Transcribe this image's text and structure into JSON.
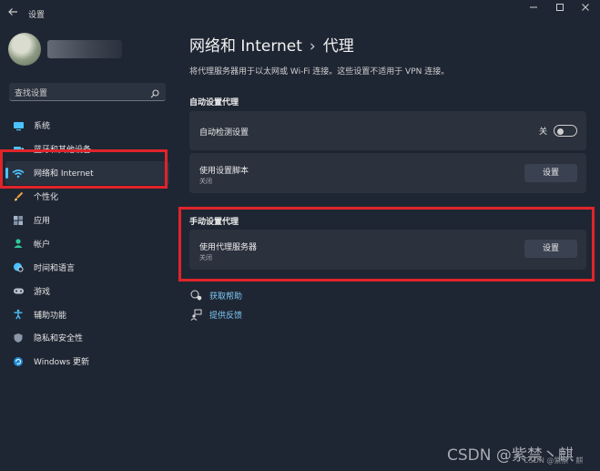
{
  "window": {
    "title": "设置"
  },
  "search": {
    "placeholder": "查找设置"
  },
  "sidebar": {
    "items": [
      {
        "label": "系统",
        "icon": "monitor-icon"
      },
      {
        "label": "蓝牙和其他设备",
        "icon": "bluetooth-icon"
      },
      {
        "label": "网络和 Internet",
        "icon": "wifi-icon",
        "active": true
      },
      {
        "label": "个性化",
        "icon": "brush-icon"
      },
      {
        "label": "应用",
        "icon": "apps-icon"
      },
      {
        "label": "帐户",
        "icon": "person-icon"
      },
      {
        "label": "时间和语言",
        "icon": "globe-clock-icon"
      },
      {
        "label": "游戏",
        "icon": "gamepad-icon"
      },
      {
        "label": "辅助功能",
        "icon": "accessibility-icon"
      },
      {
        "label": "隐私和安全性",
        "icon": "shield-icon"
      },
      {
        "label": "Windows 更新",
        "icon": "update-icon"
      }
    ]
  },
  "header": {
    "breadcrumb_parent": "网络和 Internet",
    "breadcrumb_sep": "›",
    "breadcrumb_current": "代理",
    "description": "将代理服务器用于以太网或 Wi-Fi 连接。这些设置不适用于 VPN 连接。"
  },
  "auto_proxy": {
    "section_title": "自动设置代理",
    "detect": {
      "label": "自动检测设置",
      "toggle_text": "关",
      "on": false
    },
    "script": {
      "label": "使用设置脚本",
      "sub": "关闭",
      "button": "设置"
    }
  },
  "manual_proxy": {
    "section_title": "手动设置代理",
    "server": {
      "label": "使用代理服务器",
      "sub": "关闭",
      "button": "设置"
    }
  },
  "links": {
    "help": "获取帮助",
    "feedback": "提供反馈"
  },
  "watermark": {
    "main": "CSDN @紫禁丶麒",
    "small": "CSDN @紫禁丶麒"
  },
  "colors": {
    "background": "#1f2633",
    "card": "#2b313d",
    "accent": "#4cc2ff",
    "link": "#7cc8f5",
    "highlight_box": "#e0242a"
  }
}
